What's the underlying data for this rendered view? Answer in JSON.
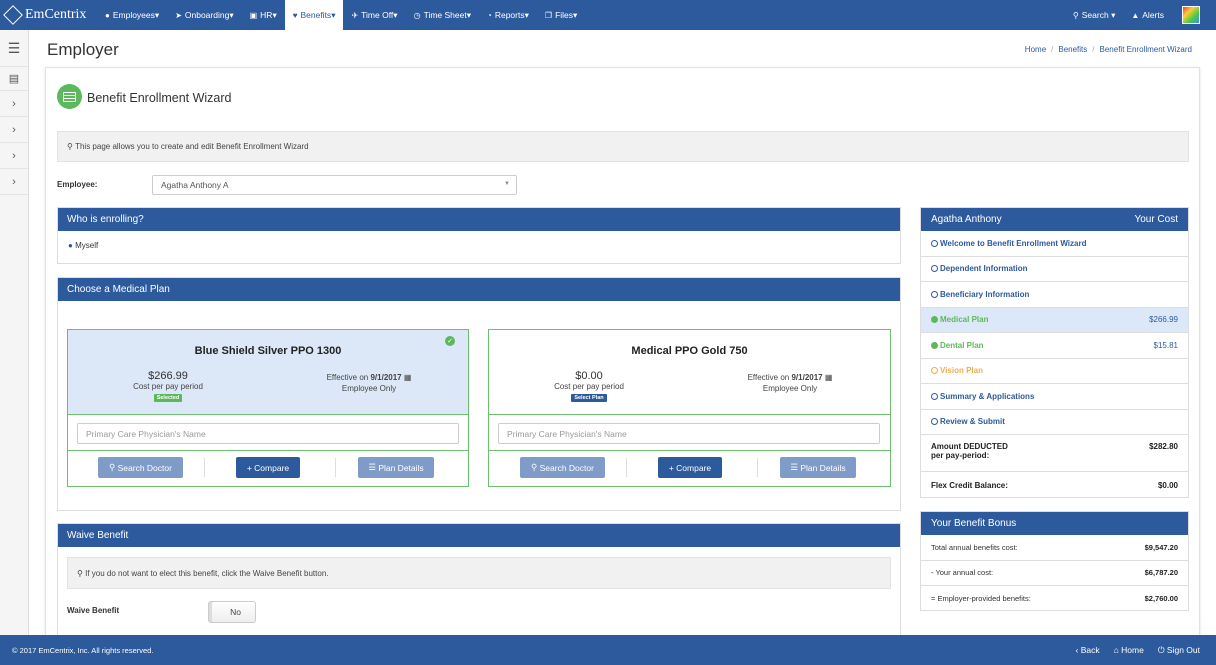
{
  "brand": {
    "name": "EmCentrix"
  },
  "nav": {
    "items": [
      {
        "label": "Employees",
        "icon": "users-icon"
      },
      {
        "label": "Onboarding",
        "icon": "rocket-icon"
      },
      {
        "label": "HR",
        "icon": "briefcase-icon"
      },
      {
        "label": "Benefits",
        "icon": "heart-icon"
      },
      {
        "label": "Time Off",
        "icon": "plane-icon"
      },
      {
        "label": "Time Sheet",
        "icon": "clock-icon"
      },
      {
        "label": "Reports",
        "icon": "chart-icon"
      },
      {
        "label": "Files",
        "icon": "files-icon"
      }
    ],
    "active": "Benefits",
    "search_label": "Search",
    "alerts_label": "Alerts"
  },
  "header": {
    "title": "Employer",
    "breadcrumb": [
      "Home",
      "Benefits",
      "Benefit Enrollment Wizard"
    ]
  },
  "wizard": {
    "title": "Benefit Enrollment Wizard",
    "info": "This page allows you to create and edit Benefit Enrollment Wizard",
    "employee_label": "Employee:",
    "employee_value": "Agatha Anthony A"
  },
  "enrolling": {
    "title": "Who is enrolling?",
    "value": "Myself"
  },
  "medical": {
    "title": "Choose a Medical Plan",
    "placeholder": "Primary Care Physician's Name",
    "plans": [
      {
        "name": "Blue Shield Silver PPO 1300",
        "price": "$266.99",
        "price_label": "Cost per pay period",
        "badge": "Selected",
        "effective_prefix": "Effective on",
        "effective_date": "9/1/2017",
        "coverage": "Employee Only",
        "selected": true
      },
      {
        "name": "Medical PPO Gold 750",
        "price": "$0.00",
        "price_label": "Cost per pay period",
        "badge": "Select Plan",
        "effective_prefix": "Effective on",
        "effective_date": "9/1/2017",
        "coverage": "Employee Only",
        "selected": false
      }
    ],
    "buttons": {
      "search": "Search Doctor",
      "compare": "Compare",
      "details": "Plan Details"
    }
  },
  "waive": {
    "title": "Waive Benefit",
    "info": "If you do not want to elect this benefit, click the Waive Benefit button.",
    "label": "Waive Benefit",
    "toggle": "No"
  },
  "sidebar": {
    "name": "Agatha Anthony",
    "cost_header": "Your Cost",
    "steps": [
      {
        "label": "Welcome to Benefit Enrollment Wizard",
        "cost": "",
        "state": "pending"
      },
      {
        "label": "Dependent Information",
        "cost": "",
        "state": "pending"
      },
      {
        "label": "Beneficiary Information",
        "cost": "",
        "state": "pending"
      },
      {
        "label": "Medical Plan",
        "cost": "$266.99",
        "state": "current"
      },
      {
        "label": "Dental Plan",
        "cost": "$15.81",
        "state": "done"
      },
      {
        "label": "Vision Plan",
        "cost": "",
        "state": "warn"
      },
      {
        "label": "Summary & Applications",
        "cost": "",
        "state": "pending"
      },
      {
        "label": "Review & Submit",
        "cost": "",
        "state": "pending"
      }
    ],
    "deducted_label_1": "Amount DEDUCTED",
    "deducted_label_2": "per pay-period:",
    "deducted_value": "$282.80",
    "flex_label": "Flex Credit Balance:",
    "flex_value": "$0.00"
  },
  "bonus": {
    "title": "Your Benefit Bonus",
    "rows": [
      {
        "label": "Total annual benefits cost:",
        "value": "$9,547.20"
      },
      {
        "label": "- Your annual cost:",
        "value": "$6,787.20"
      },
      {
        "label": "= Employer-provided benefits:",
        "value": "$2,760.00"
      }
    ]
  },
  "footer": {
    "copyright": "© 2017 EmCentrix, Inc. All rights reserved.",
    "back": "Back",
    "home": "Home",
    "signout": "Sign Out"
  },
  "colors": {
    "primary": "#2d5a9c",
    "success": "#5cb85c",
    "warning": "#f0ad4e"
  }
}
